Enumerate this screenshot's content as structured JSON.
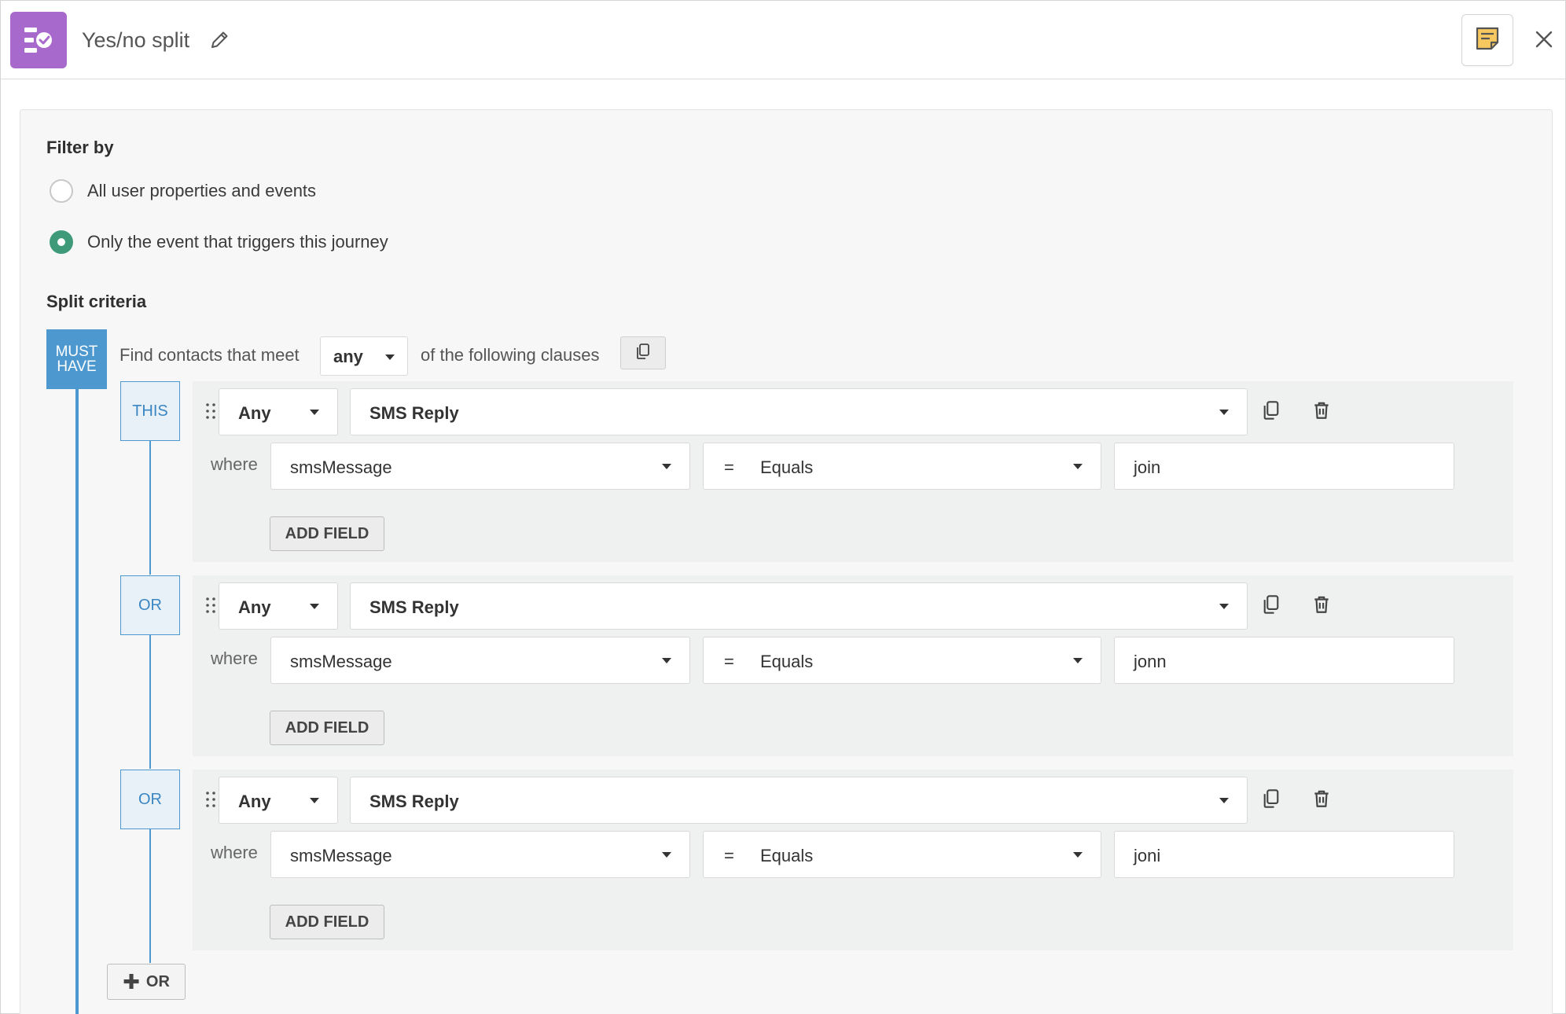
{
  "header": {
    "title": "Yes/no split",
    "app_icon": "journey-split-icon",
    "edit_icon": "pencil-icon",
    "notes_icon": "sticky-note-icon",
    "close_icon": "close-icon",
    "accent_color": "#a869cc"
  },
  "filter": {
    "title": "Filter by",
    "options": [
      {
        "label": "All user properties and events",
        "checked": false
      },
      {
        "label": "Only the event that triggers this journey",
        "checked": true
      }
    ],
    "radio_color": "#3f9a7a"
  },
  "split": {
    "title": "Split criteria",
    "must_have": {
      "line1": "MUST",
      "line2": "HAVE"
    },
    "find_prefix": "Find contacts that meet",
    "match_value": "any",
    "find_suffix": "of the following clauses",
    "accent_color": "#4e98d0",
    "clauses": [
      {
        "tag": "THIS",
        "quantifier": "Any",
        "event": "SMS Reply",
        "where_label": "where",
        "property": "smsMessage",
        "operator_symbol": "=",
        "operator": "Equals",
        "value": "join",
        "add_field_label": "ADD FIELD"
      },
      {
        "tag": "OR",
        "quantifier": "Any",
        "event": "SMS Reply",
        "where_label": "where",
        "property": "smsMessage",
        "operator_symbol": "=",
        "operator": "Equals",
        "value": "jonn",
        "add_field_label": "ADD FIELD"
      },
      {
        "tag": "OR",
        "quantifier": "Any",
        "event": "SMS Reply",
        "where_label": "where",
        "property": "smsMessage",
        "operator_symbol": "=",
        "operator": "Equals",
        "value": "joni",
        "add_field_label": "ADD FIELD"
      }
    ],
    "add_or": {
      "plus": "✚",
      "label": "OR"
    }
  }
}
